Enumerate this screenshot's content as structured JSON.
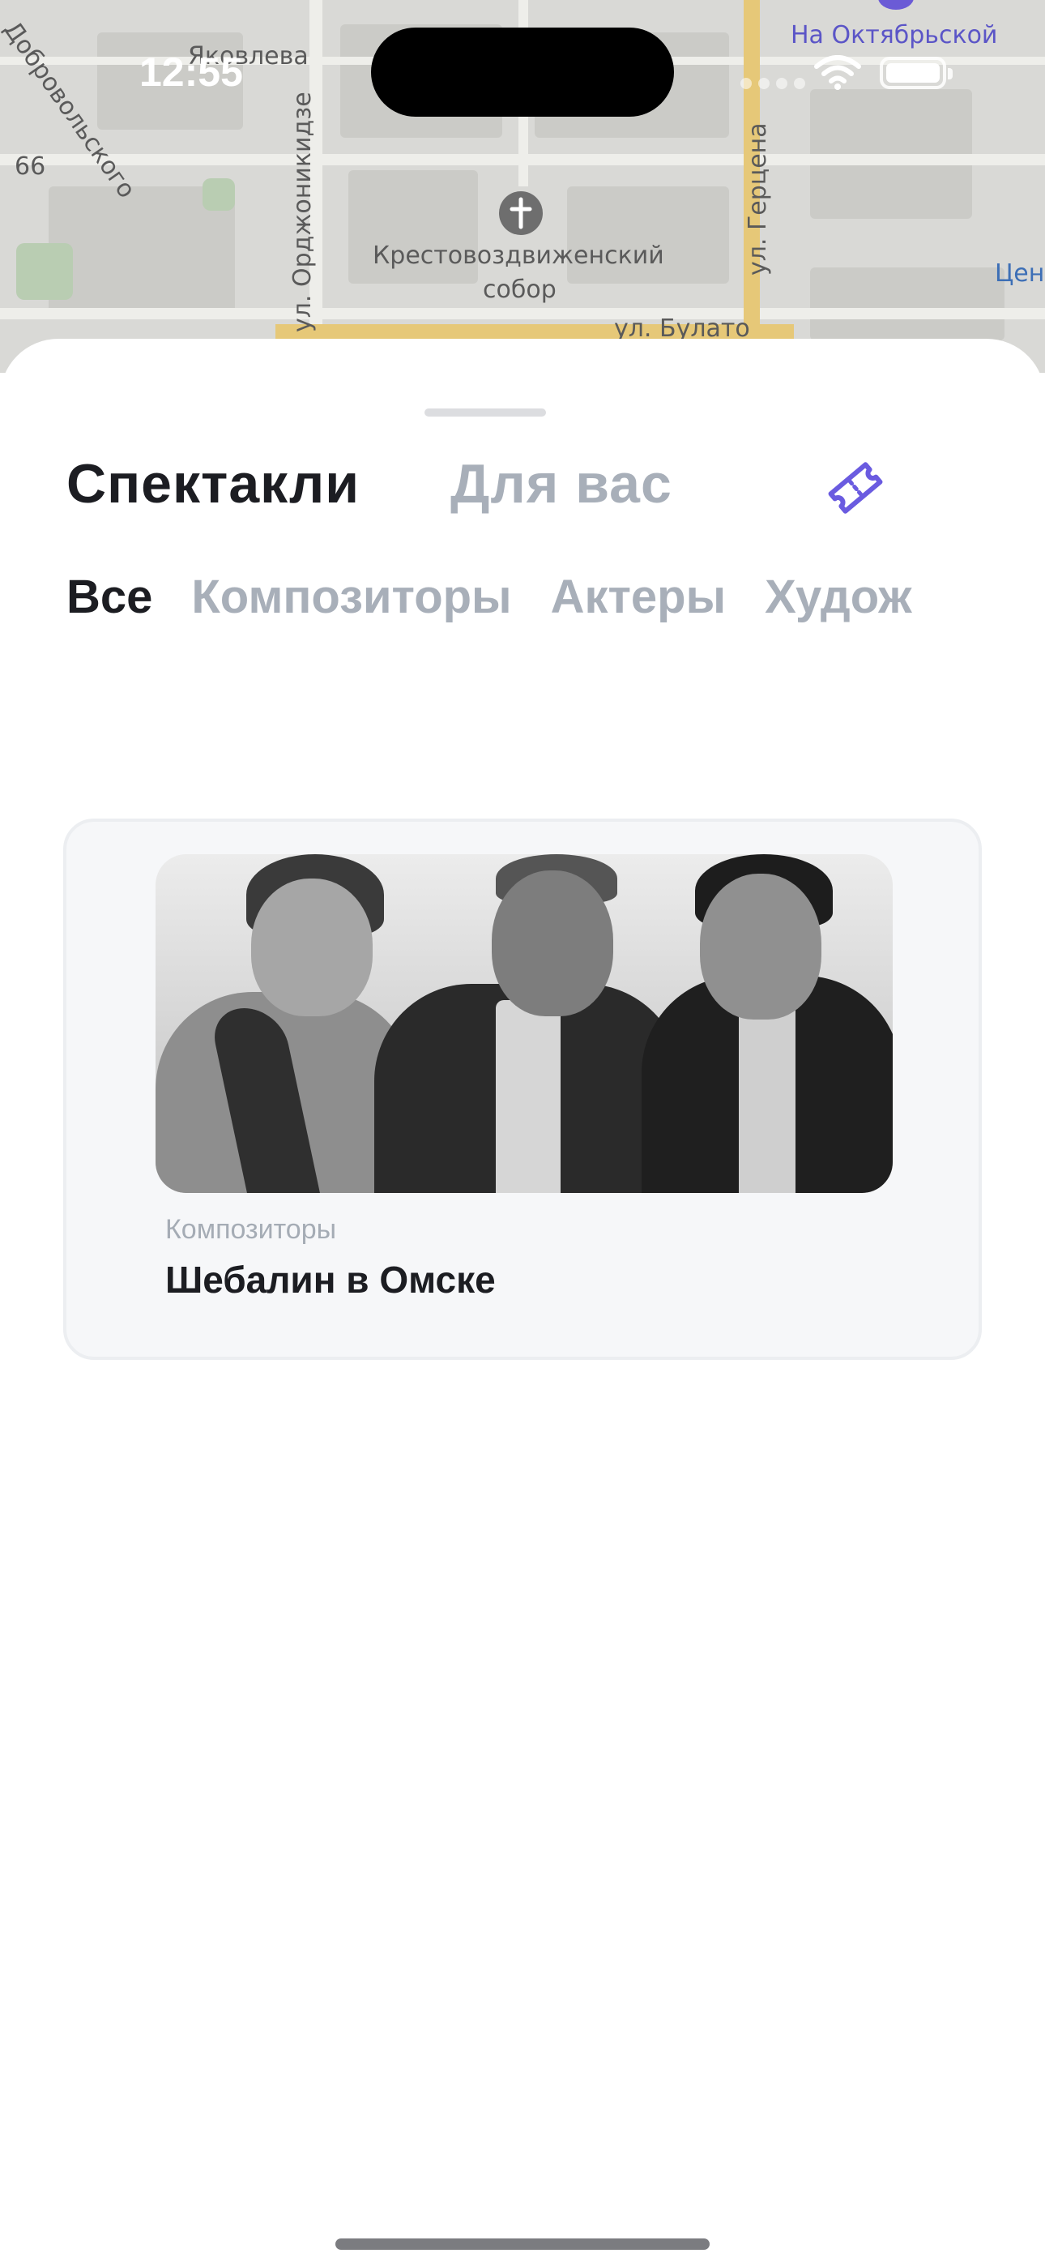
{
  "status_bar": {
    "time": "12:55"
  },
  "map": {
    "labels": {
      "street_yakovleva": "Яковлева",
      "street_dobrovolskogo": "Добровольского",
      "house_66": "66",
      "street_ordzhonikidze": "ул. Орджоникидзе",
      "street_gertsena": "ул. Герцена",
      "street_bulatova": "ул. Булато",
      "cathedral_line1": "Крестовоздвиженский",
      "cathedral_line2": "собор",
      "metro": "На Октябрьской",
      "center_edge": "Цен"
    },
    "accent_metro": "#5b55c7"
  },
  "sheet": {
    "main_tabs": [
      {
        "label": "Спектакли",
        "active": true
      },
      {
        "label": "Для вас",
        "active": false
      }
    ],
    "ticket_icon": "ticket-icon",
    "sub_tabs": [
      {
        "label": "Все",
        "active": true
      },
      {
        "label": "Композиторы",
        "active": false
      },
      {
        "label": "Актеры",
        "active": false
      },
      {
        "label": "Худож",
        "active": false
      }
    ],
    "cards": [
      {
        "category": "Композиторы",
        "title": "Шебалин в Омске",
        "image": "black-and-white historical photo of three people"
      }
    ]
  },
  "colors": {
    "accent": "#6a5be0",
    "active_text": "#1c1d22",
    "inactive_text": "#a8afb9"
  }
}
